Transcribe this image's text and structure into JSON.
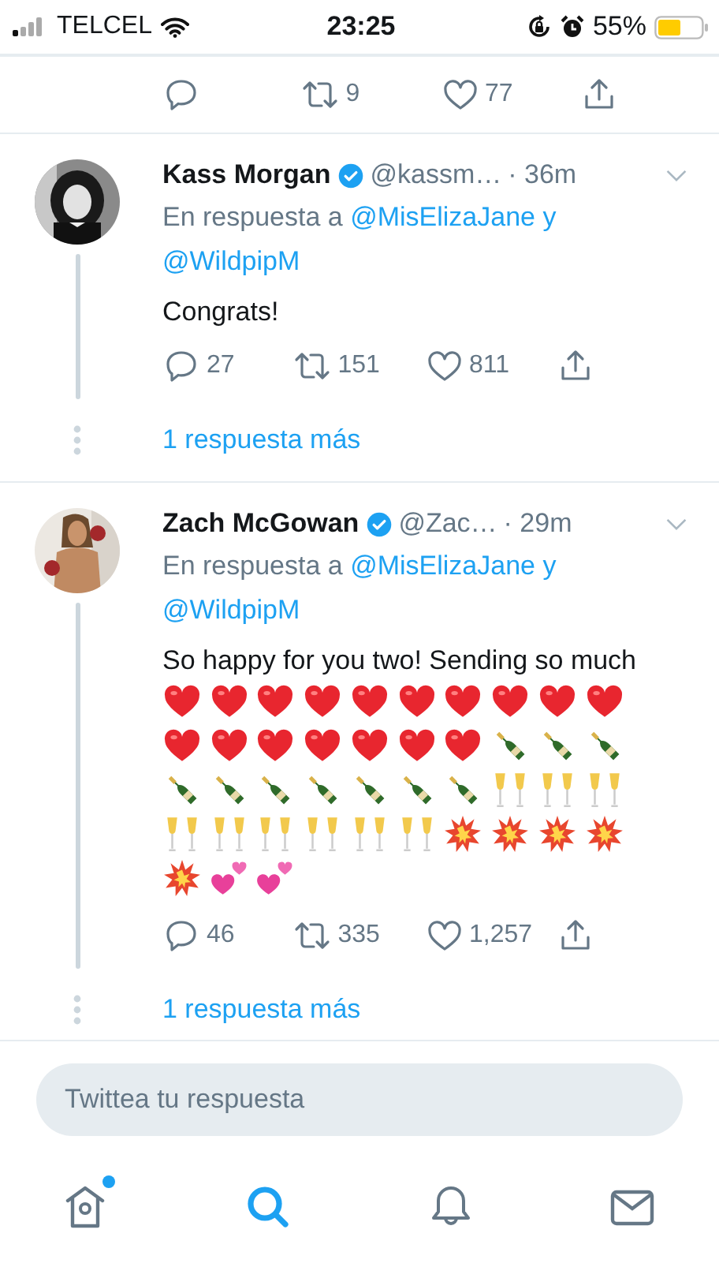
{
  "status_bar": {
    "carrier": "TELCEL",
    "time": "23:25",
    "battery": "55%"
  },
  "previous_actions": [
    {
      "kind": "reply"
    },
    {
      "kind": "retweet",
      "count": "9"
    },
    {
      "kind": "like",
      "count": "77"
    },
    {
      "kind": "share"
    }
  ],
  "tweets": [
    {
      "name": "Kass Morgan",
      "verified": true,
      "handle": "@kassm…",
      "time": "· 36m",
      "reply_prefix": "En respuesta a",
      "reply_to": [
        "@MisElizaJane",
        "@WildpipM"
      ],
      "reply_joiner": "y",
      "text": "Congrats!",
      "actions": [
        {
          "kind": "reply",
          "count": "27"
        },
        {
          "kind": "retweet",
          "count": "151"
        },
        {
          "kind": "like",
          "count": "811"
        },
        {
          "kind": "share"
        }
      ],
      "more_replies": "1 respuesta más"
    },
    {
      "name": "Zach McGowan",
      "verified": true,
      "handle": "@Zac…",
      "time": "· 29m",
      "reply_prefix": "En respuesta a",
      "reply_to": [
        "@MisElizaJane",
        "@WildpipM"
      ],
      "reply_joiner": "y",
      "text": "So happy for you two! Sending so much",
      "emojis": [
        {
          "kind": "heart"
        },
        {
          "kind": "heart"
        },
        {
          "kind": "heart"
        },
        {
          "kind": "heart"
        },
        {
          "kind": "heart"
        },
        {
          "kind": "heart"
        },
        {
          "kind": "heart"
        },
        {
          "kind": "heart"
        },
        {
          "kind": "heart"
        },
        {
          "kind": "heart"
        },
        {
          "kind": "heart"
        },
        {
          "kind": "heart"
        },
        {
          "kind": "heart"
        },
        {
          "kind": "heart"
        },
        {
          "kind": "heart"
        },
        {
          "kind": "heart"
        },
        {
          "kind": "heart"
        },
        {
          "kind": "bottle"
        },
        {
          "kind": "bottle"
        },
        {
          "kind": "bottle"
        },
        {
          "kind": "bottle"
        },
        {
          "kind": "bottle"
        },
        {
          "kind": "bottle"
        },
        {
          "kind": "bottle"
        },
        {
          "kind": "bottle"
        },
        {
          "kind": "bottle"
        },
        {
          "kind": "bottle"
        },
        {
          "kind": "glasses"
        },
        {
          "kind": "glasses"
        },
        {
          "kind": "glasses"
        },
        {
          "kind": "glasses"
        },
        {
          "kind": "glasses"
        },
        {
          "kind": "glasses"
        },
        {
          "kind": "glasses"
        },
        {
          "kind": "glasses"
        },
        {
          "kind": "glasses"
        },
        {
          "kind": "burst"
        },
        {
          "kind": "burst"
        },
        {
          "kind": "burst"
        },
        {
          "kind": "burst"
        },
        {
          "kind": "burst"
        },
        {
          "kind": "two_hearts"
        },
        {
          "kind": "two_hearts"
        }
      ],
      "actions": [
        {
          "kind": "reply",
          "count": "46"
        },
        {
          "kind": "retweet",
          "count": "335"
        },
        {
          "kind": "like",
          "count": "1,257"
        },
        {
          "kind": "share"
        }
      ],
      "more_replies": "1 respuesta más"
    }
  ],
  "composer": {
    "placeholder": "Twittea tu respuesta"
  },
  "tabs": [
    {
      "kind": "home",
      "selected": false,
      "unread": true
    },
    {
      "kind": "search",
      "selected": true,
      "unread": false
    },
    {
      "kind": "notifications",
      "selected": false,
      "unread": false
    },
    {
      "kind": "messages",
      "selected": false,
      "unread": false
    }
  ]
}
